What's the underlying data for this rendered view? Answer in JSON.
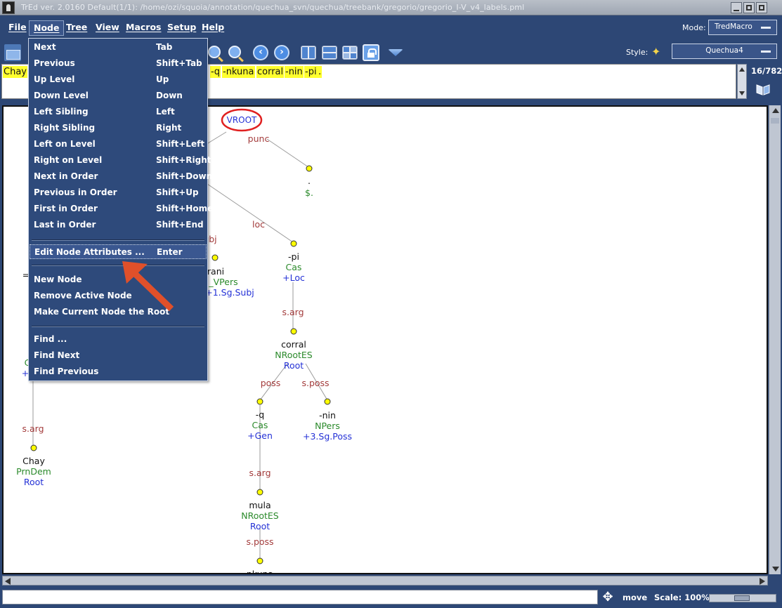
{
  "window": {
    "title": "TrEd ver. 2.0160   Default(1/1): /home/ozi/squoia/annotation/quechua_svn/quechua/treebank/gregorio/gregorio_I-V_v4_labels.pml"
  },
  "menubar": {
    "items": [
      {
        "label": "File"
      },
      {
        "label": "Node"
      },
      {
        "label": "Tree"
      },
      {
        "label": "View"
      },
      {
        "label": "Macros"
      },
      {
        "label": "Setup"
      },
      {
        "label": "Help"
      }
    ],
    "mode_label": "Mode:",
    "mode_value": "TredMacro"
  },
  "toolbar": {
    "style_label": "Style:",
    "style_value": "Quechua4"
  },
  "sentence": {
    "tokens": [
      {
        "text": "Chay",
        "highlight": true
      },
      {
        "text": "-q",
        "highlight": true
      },
      {
        "text": "-nkuna",
        "highlight": true
      },
      {
        "text": "corral",
        "highlight": true
      },
      {
        "text": "-nin",
        "highlight": true
      },
      {
        "text": "-pi",
        "highlight": true
      },
      {
        "text": ".",
        "highlight": true
      }
    ],
    "counter": "16/782"
  },
  "node_menu": {
    "groups": [
      [
        {
          "label": "Next",
          "accel": "Tab"
        },
        {
          "label": "Previous",
          "accel": "Shift+Tab"
        },
        {
          "label": "Up Level",
          "accel": "Up"
        },
        {
          "label": "Down Level",
          "accel": "Down"
        },
        {
          "label": "Left Sibling",
          "accel": "Left"
        },
        {
          "label": "Right Sibling",
          "accel": "Right"
        },
        {
          "label": "Left on Level",
          "accel": "Shift+Left"
        },
        {
          "label": "Right on Level",
          "accel": "Shift+Right"
        },
        {
          "label": "Next in Order",
          "accel": "Shift+Down"
        },
        {
          "label": "Previous in Order",
          "accel": "Shift+Up"
        },
        {
          "label": "First in Order",
          "accel": "Shift+Home"
        },
        {
          "label": "Last in Order",
          "accel": "Shift+End"
        }
      ],
      [
        {
          "label": "Edit Node Attributes ...",
          "accel": "Enter",
          "selected": true
        }
      ],
      [
        {
          "label": "New Node",
          "accel": ""
        },
        {
          "label": "Remove Active Node",
          "accel": ""
        },
        {
          "label": "Make Current Node the Root",
          "accel": ""
        }
      ],
      [
        {
          "label": "Find ...",
          "accel": ""
        },
        {
          "label": "Find Next",
          "accel": ""
        },
        {
          "label": "Find Previous",
          "accel": ""
        }
      ]
    ]
  },
  "tree": {
    "root_label": "VROOT",
    "edges": [
      "punc",
      "loc",
      "ubj",
      "s.arg",
      "s.arg",
      "poss",
      "s.poss",
      "s.arg",
      "s.poss",
      "s.arg"
    ],
    "nodes": [
      {
        "form": ".",
        "pos": "$.",
        "morph": ""
      },
      {
        "form": "-pi",
        "pos": "Cas",
        "morph": "+Loc"
      },
      {
        "form": "rani",
        "pos": "_VPers",
        "morph": "+1.Sg.Subj"
      },
      {
        "form": "corral",
        "pos": "NRootES",
        "morph": "Root"
      },
      {
        "form": "-q",
        "pos": "Cas",
        "morph": "+Gen"
      },
      {
        "form": "-nin",
        "pos": "NPers",
        "morph": "+3.Sg.Poss"
      },
      {
        "form": "Chay",
        "pos": "PrnDem",
        "morph": "Root"
      },
      {
        "form": "mula",
        "pos": "NRootES",
        "morph": "Root"
      },
      {
        "form": "=",
        "pos": "C",
        "morph": "+"
      },
      {
        "form": "pkuna",
        "pos": "",
        "morph": ""
      }
    ]
  },
  "statusbar": {
    "mode": "move",
    "scale": "Scale: 100%",
    "scale_percent": 50
  },
  "colors": {
    "menu_bg": "#2e4a7b",
    "edge_label": "#a33b3b",
    "pos_label": "#2b8a2b",
    "morph_label": "#2431d6",
    "node_fill": "#ffff00",
    "root_ring": "#e02020",
    "highlight": "#ffff2e",
    "arrow": "#e0502a"
  }
}
